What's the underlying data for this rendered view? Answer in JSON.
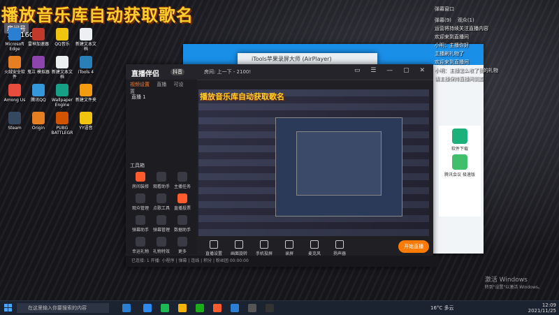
{
  "overlay": {
    "title": "播放音乐库自动获取歌名",
    "room_label": "房间号",
    "room_id": "10216093"
  },
  "desktop_icons": [
    {
      "label": "Microsoft Edge",
      "color": "#2a7fd3"
    },
    {
      "label": "雷神加速器",
      "color": "#c0392b"
    },
    {
      "label": "QQ音乐",
      "color": "#f1c40f"
    },
    {
      "label": "新建文本文档",
      "color": "#ecf0f1"
    },
    {
      "label": "火绒安全软件",
      "color": "#e67e22"
    },
    {
      "label": "鬼泣 模拟器",
      "color": "#8e44ad"
    },
    {
      "label": "新建文本文档",
      "color": "#ecf0f1"
    },
    {
      "label": "iTools 4",
      "color": "#2980b9"
    },
    {
      "label": "Among Us",
      "color": "#e74c3c"
    },
    {
      "label": "腾讯QQ",
      "color": "#3498db"
    },
    {
      "label": "Wallpaper Engine",
      "color": "#16a085"
    },
    {
      "label": "新建文件夹",
      "color": "#f39c12"
    },
    {
      "label": "Steam",
      "color": "#34495e"
    },
    {
      "label": "Origin",
      "color": "#e67e22"
    },
    {
      "label": "PUBG BATTLEGR",
      "color": "#d35400"
    },
    {
      "label": "YY语音",
      "color": "#f1c40f"
    }
  ],
  "itools": {
    "header_title": "iTools苹果录屏大师 (AirPlayer)"
  },
  "zhibo": {
    "logo": "直播伴侣",
    "tag": "抖音",
    "room_title": "房间: 上一下 - 2100!",
    "tabs": [
      "视频设置",
      "直播",
      "可设置"
    ],
    "scene": "直播 1",
    "tools_label": "工具箱",
    "tools": [
      {
        "label": "房间装修",
        "hot": true
      },
      {
        "label": "观看助手",
        "hot": false
      },
      {
        "label": "主播任务",
        "hot": false
      },
      {
        "label": "观众管理",
        "hot": false
      },
      {
        "label": "点歌工具",
        "hot": false
      },
      {
        "label": "直播投票",
        "hot": true
      },
      {
        "label": "弹幕助手",
        "hot": false
      },
      {
        "label": "弹幕管理",
        "hot": false
      },
      {
        "label": "数据助手",
        "hot": false
      },
      {
        "label": "幸运礼物",
        "hot": false
      },
      {
        "label": "礼物特效",
        "hot": false
      },
      {
        "label": "更多",
        "hot": false
      }
    ],
    "bottom_items": [
      "直播设置",
      "画面旋转",
      "手机投屏",
      "录屏",
      "麦克风",
      "扬声器"
    ],
    "live_button": "开始直播",
    "statusline": "已连接: 1 开播: 小程序 | 弹幕 | 连线 | 积分 | 粉丝团 00:00:00"
  },
  "chat": {
    "top_label": "弹幕窗口",
    "tabs": [
      "弹幕(9)",
      "观众(1)"
    ],
    "messages": [
      "运营将持续关注直播内容",
      "欢迎来到直播间",
      "小明：主播你好",
      "主播刷礼物了",
      "欢迎来到直播间",
      "小明：主播怎么收了我的礼物",
      "请主播保持直播间氛围"
    ],
    "side_items": [
      "软件下载",
      "腾讯会议 极速版"
    ]
  },
  "activation": {
    "title": "激活 Windows",
    "subtitle": "转到\"设置\"以激活 Windows。"
  },
  "taskbar": {
    "search_placeholder": "在这里输入你要搜索的内容",
    "weather": "16°C 多云",
    "time": "12:09",
    "date": "2021/11/25"
  }
}
